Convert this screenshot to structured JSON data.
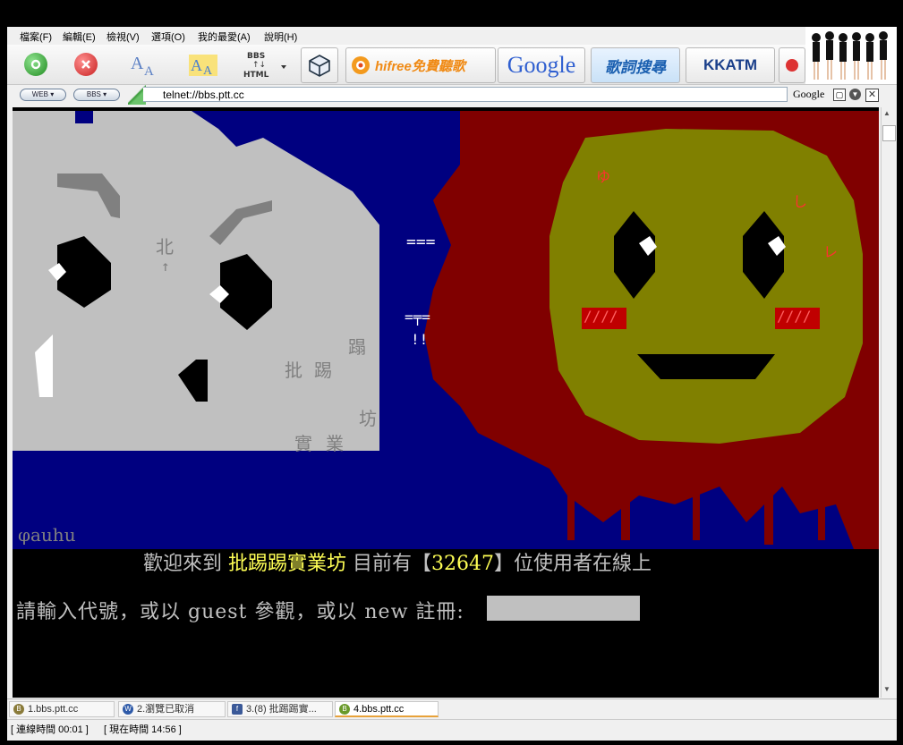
{
  "menu": [
    "檔案(F)",
    "編輯(E)",
    "檢視(V)",
    "選項(O)",
    "我的最愛(A)",
    "說明(H)"
  ],
  "toolbar": {
    "bbs_html_label": "BBS\n↑↓\nHTML",
    "hifree_label": "hifree免費聽歌",
    "google_label": "Google",
    "lyrics_label": "歌詞搜尋",
    "kkatm_label": "KKATM"
  },
  "address": {
    "web_pill": "WEB",
    "bbs_pill": "BBS",
    "url": "telnet://bbs.ptt.cc",
    "search_engine": "Google"
  },
  "terminal": {
    "art_left_chars": [
      "北",
      "↑",
      "蹋",
      "批",
      "踢",
      "坊",
      "實",
      "業"
    ],
    "signature": "φauhu",
    "welcome_prefix": "歡迎來到 ",
    "site_name": "批踢踢實業坊",
    "welcome_middle": " 目前有【",
    "online_count": "32647",
    "welcome_suffix": "】位使用者在線上",
    "login_prompt": "請輸入代號，或以 guest 參觀，或以 new 註冊: ",
    "login_value": "",
    "face_cheek": "////",
    "face_marks": [
      "ゆ",
      "し",
      "レ"
    ]
  },
  "tabs": [
    {
      "icon": "B",
      "label": "1.bbs.ptt.cc",
      "color": "#8a7b3a"
    },
    {
      "icon": "W",
      "label": "2.瀏覽已取消",
      "color": "#2e5aa8"
    },
    {
      "icon": "f",
      "label": "3.(8) 批踢踢實...",
      "color": "#3b5998"
    },
    {
      "icon": "B",
      "label": "4.bbs.ptt.cc",
      "color": "#6a9a2a"
    }
  ],
  "status": {
    "connect_time": "[ 連線時間 00:01 ]",
    "current_time": "[ 現在時間 14:56 ]"
  },
  "colors": {
    "ansi_blue": "#000080",
    "ansi_red": "#800000",
    "ansi_olive": "#808000",
    "ansi_gray": "#c0c0c0",
    "ansi_yellow": "#ffff55"
  }
}
